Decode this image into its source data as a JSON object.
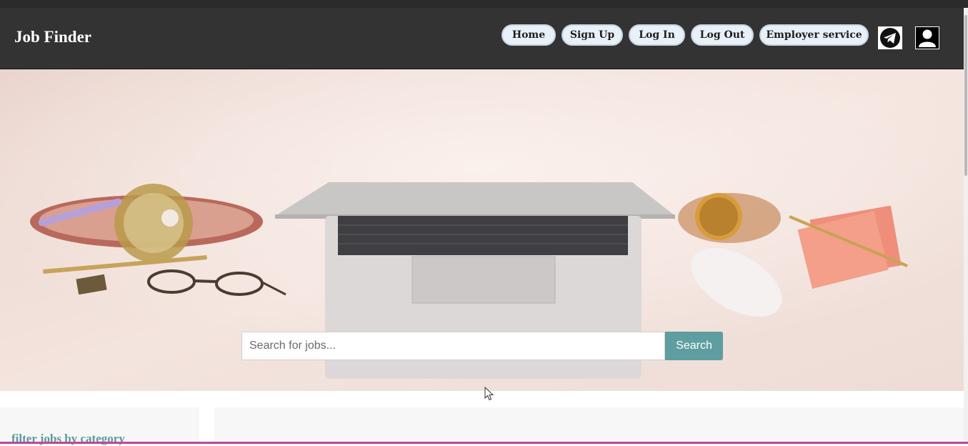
{
  "brand": "Job Finder",
  "nav": {
    "items": [
      {
        "label": "Home"
      },
      {
        "label": "Sign Up"
      },
      {
        "label": "Log In"
      },
      {
        "label": "Log Out"
      },
      {
        "label": "Employer service"
      }
    ],
    "icons": [
      "telegram-icon",
      "user-profile-icon"
    ]
  },
  "search": {
    "placeholder": "Search for jobs...",
    "value": "",
    "button_label": "Search"
  },
  "sidebar": {
    "title": "filter jobs by category"
  },
  "colors": {
    "navbar_bg": "#333333",
    "nav_button_bg": "#e8f0f8",
    "accent_teal": "#5e9ea0",
    "bottom_border": "#c2459c"
  }
}
